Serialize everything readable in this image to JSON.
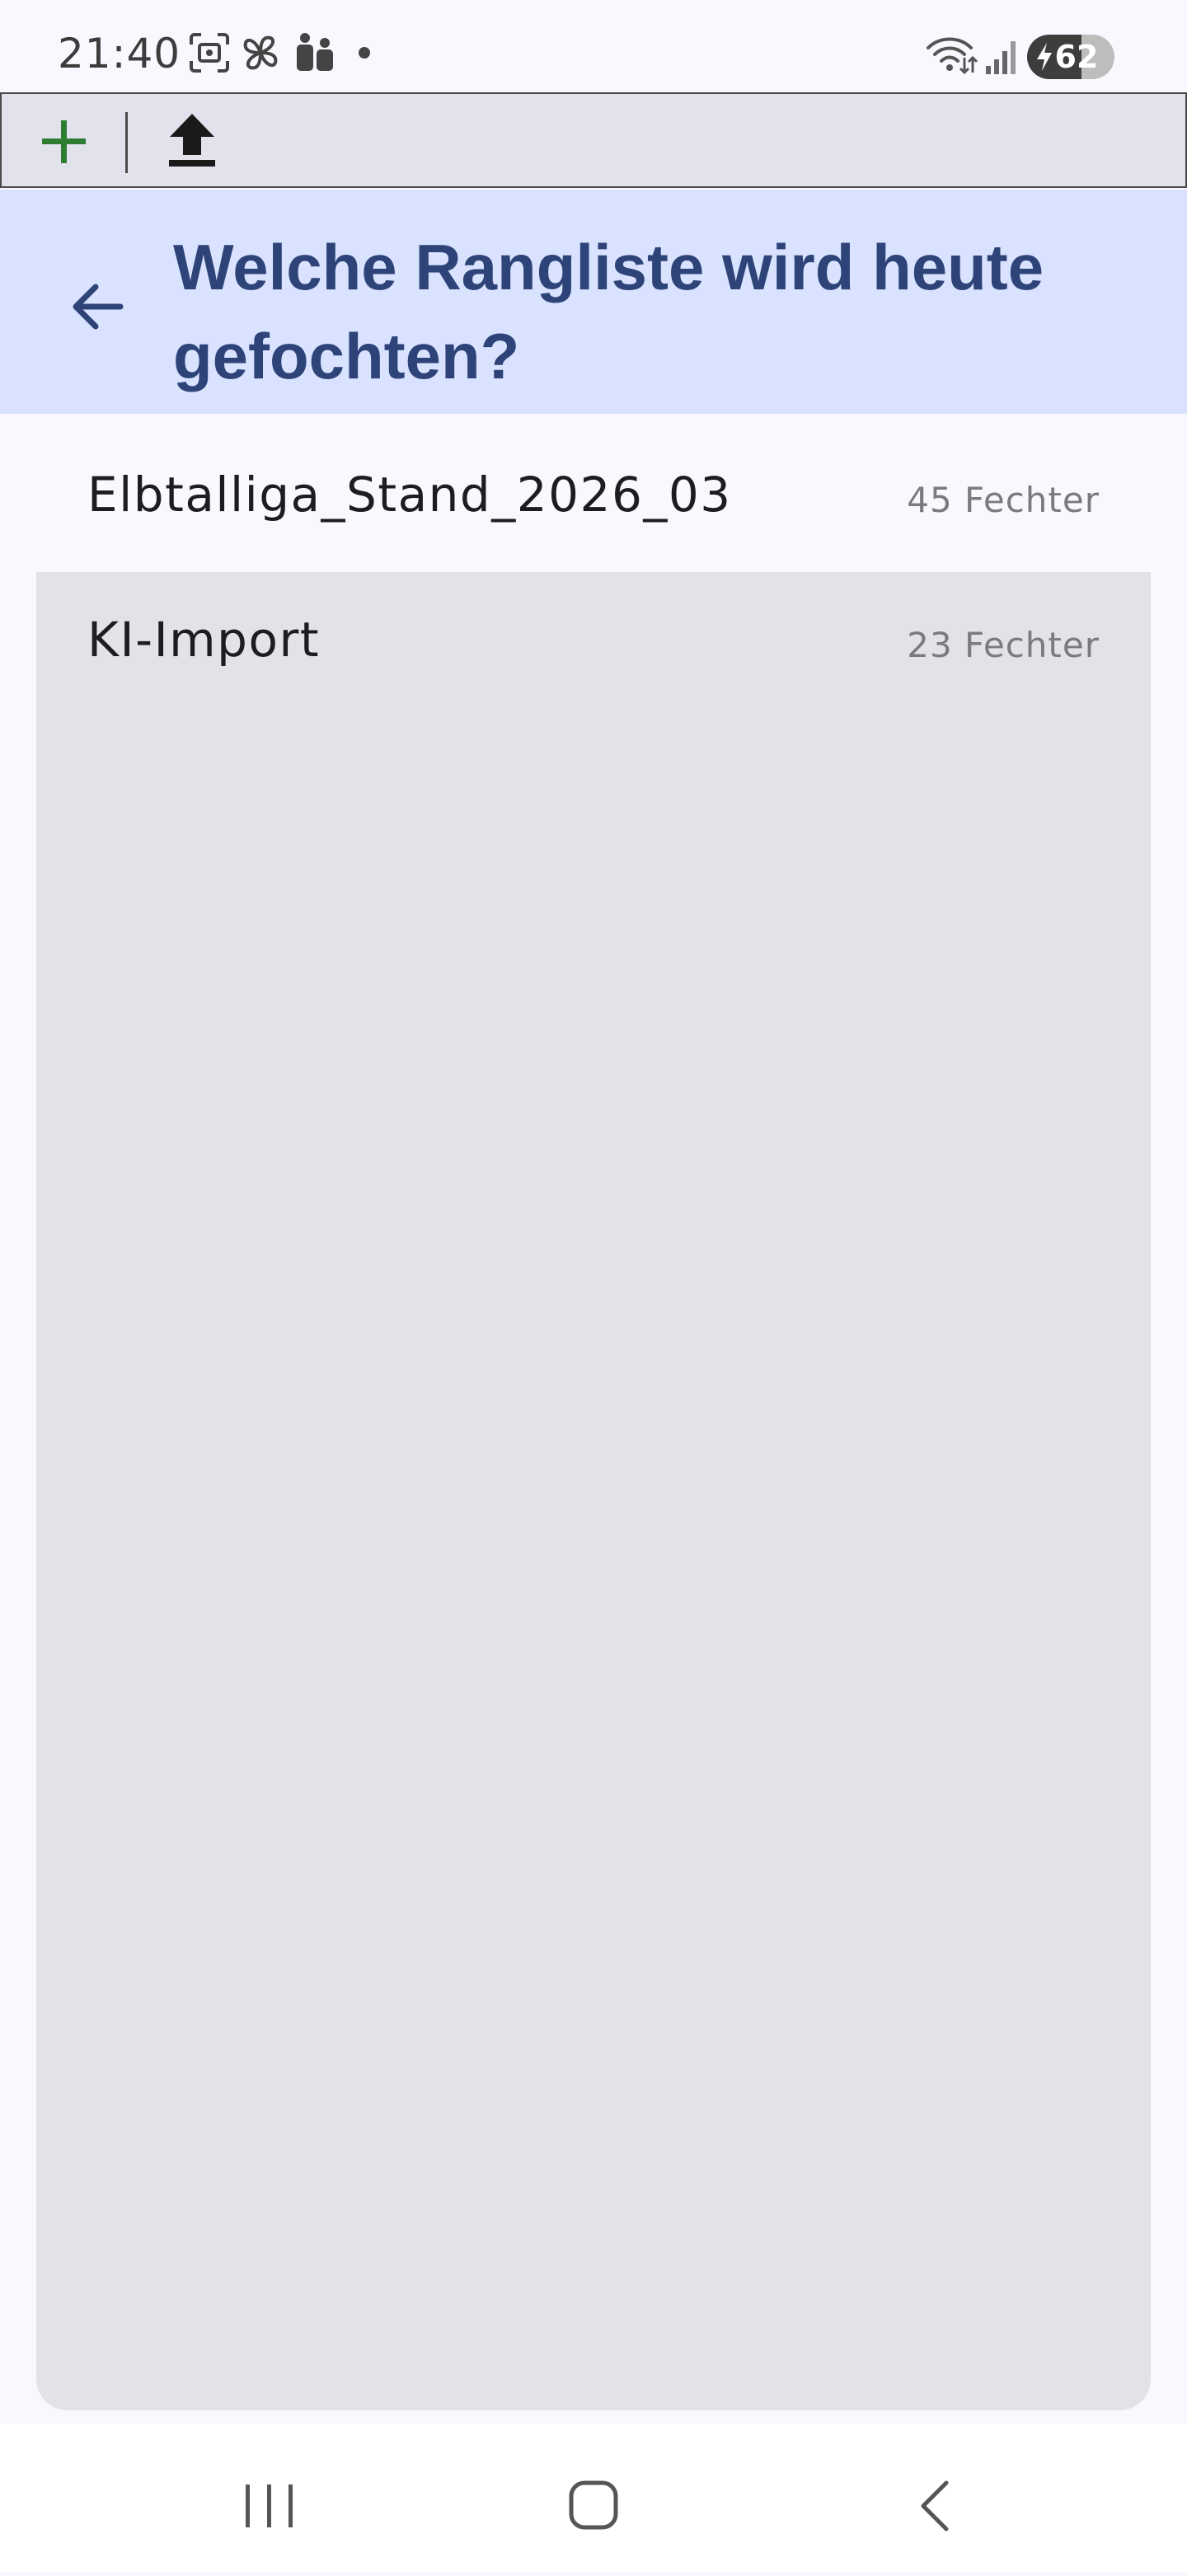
{
  "status_bar": {
    "time": "21:40",
    "battery_level": "62",
    "battery_fraction": 0.62,
    "icons": [
      "screenshot-icon",
      "pinwheel-icon",
      "people-icon",
      "dot-icon",
      "wifi-icon",
      "signal-icon",
      "battery-icon"
    ]
  },
  "toolbar": {
    "add_icon": "plus-icon",
    "upload_icon": "upload-icon",
    "colors": {
      "add": "#2e7d32",
      "upload": "#1a1a1a"
    }
  },
  "header": {
    "back_icon": "arrow-left-icon",
    "title": "Welche Rangliste wird heute gefochten?",
    "colors": {
      "background": "#d9e2ff",
      "text": "#2e4478"
    }
  },
  "rankings": {
    "items": [
      {
        "name": "Elbtalliga_Stand_2026_03",
        "count": "45 Fechter",
        "selected": false
      },
      {
        "name": "KI-Import",
        "count": "23 Fechter",
        "selected": true
      }
    ]
  },
  "navigation": {
    "icons": [
      "recent-apps-icon",
      "home-icon",
      "back-icon"
    ]
  }
}
